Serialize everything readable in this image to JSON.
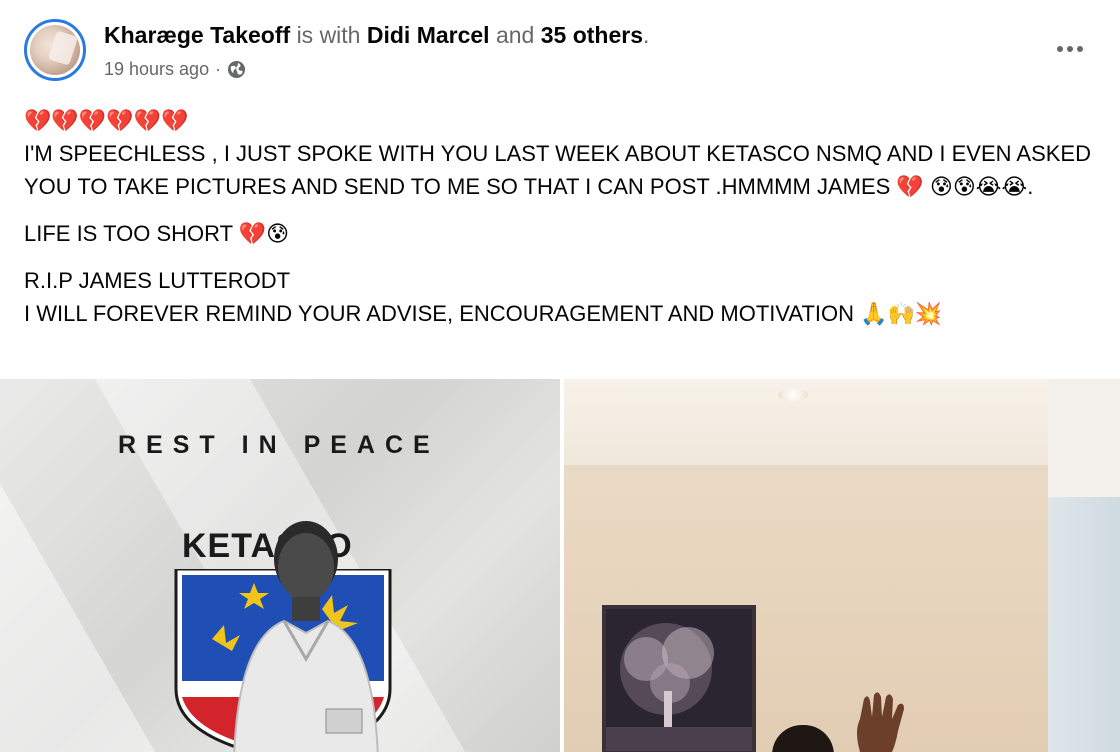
{
  "post": {
    "author": "Kharæge Takeoff",
    "with_text": "is with",
    "tagged": "Didi Marcel",
    "and_text": "and",
    "others": "35 others",
    "period": ".",
    "time": "19 hours ago",
    "separator": "·",
    "privacy_icon": "globe-icon",
    "more_icon": "more-options-icon"
  },
  "content": {
    "hearts": "💔💔💔💔💔💔",
    "paragraph1": "I'M SPEECHLESS , I JUST SPOKE WITH YOU LAST WEEK ABOUT KETASCO NSMQ AND I EVEN ASKED YOU TO TAKE PICTURES AND SEND TO ME SO THAT I CAN POST .HMMMM JAMES 💔 😰😰😭😭.",
    "paragraph2": "LIFE IS TOO SHORT 💔😰",
    "paragraph3": "R.I.P JAMES LUTTERODT",
    "paragraph4": "I WILL FOREVER REMIND YOUR ADVISE, ENCOURAGEMENT AND MOTIVATION 🙏🙌💥"
  },
  "photos": {
    "left": {
      "heading": "REST IN PEACE",
      "school": "KETASCO"
    }
  },
  "colors": {
    "avatar_ring": "#2a7ae2",
    "muted_text": "#65676b",
    "crest_blue": "#1f4fb4",
    "crest_red": "#d4242b",
    "crest_yellow": "#f0c419"
  }
}
